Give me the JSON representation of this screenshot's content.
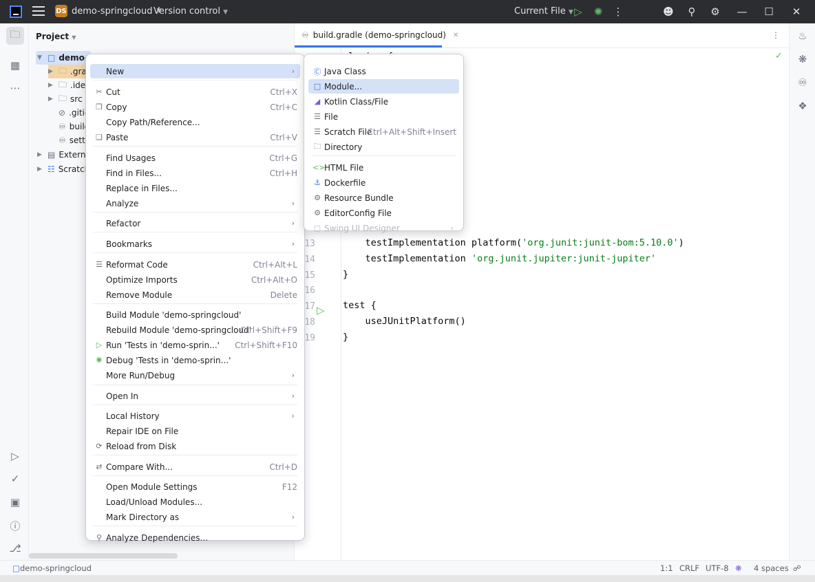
{
  "titlebar": {
    "badge": "DS",
    "project": "demo-springcloud",
    "vcs": "Version control",
    "run_config": "Current File"
  },
  "project_pane": {
    "title": "Project",
    "rows": [
      "demo-s",
      ".grac",
      ".idea",
      "src",
      ".gitic",
      "build",
      "setti",
      "External",
      "Scratche"
    ]
  },
  "editor": {
    "tab": "build.gradle (demo-springcloud)",
    "lines": [
      {
        "n": "13",
        "code": "    testImplementation platform(",
        "str": "'org.junit:junit-bom:5.10.0'",
        "tail": ")"
      },
      {
        "n": "14",
        "code": "    testImplementation ",
        "str": "'org.junit.jupiter:junit-jupiter'",
        "tail": ""
      },
      {
        "n": "15",
        "code": "}",
        "str": "",
        "tail": ""
      },
      {
        "n": "16",
        "code": "",
        "str": "",
        "tail": ""
      },
      {
        "n": "17",
        "code": "test {",
        "str": "",
        "tail": ""
      },
      {
        "n": "18",
        "code": "    useJUnitPlatform()",
        "str": "",
        "tail": ""
      },
      {
        "n": "19",
        "code": "}",
        "str": "",
        "tail": ""
      }
    ],
    "partial_top": "plugins {",
    "partial_t": "T'"
  },
  "context_menu": {
    "items": [
      {
        "label": "New",
        "shortcut": "",
        "sub": true
      },
      {
        "label": "Cut",
        "shortcut": "Ctrl+X",
        "sub": false
      },
      {
        "label": "Copy",
        "shortcut": "Ctrl+C",
        "sub": false
      },
      {
        "label": "Copy Path/Reference...",
        "shortcut": "",
        "sub": false
      },
      {
        "label": "Paste",
        "shortcut": "Ctrl+V",
        "sub": false
      },
      {
        "label": "Find Usages",
        "shortcut": "Ctrl+G",
        "sub": false
      },
      {
        "label": "Find in Files...",
        "shortcut": "Ctrl+H",
        "sub": false
      },
      {
        "label": "Replace in Files...",
        "shortcut": "",
        "sub": false
      },
      {
        "label": "Analyze",
        "shortcut": "",
        "sub": true
      },
      {
        "label": "Refactor",
        "shortcut": "",
        "sub": true
      },
      {
        "label": "Bookmarks",
        "shortcut": "",
        "sub": true
      },
      {
        "label": "Reformat Code",
        "shortcut": "Ctrl+Alt+L",
        "sub": false
      },
      {
        "label": "Optimize Imports",
        "shortcut": "Ctrl+Alt+O",
        "sub": false
      },
      {
        "label": "Remove Module",
        "shortcut": "Delete",
        "sub": false
      },
      {
        "label": "Build Module 'demo-springcloud'",
        "shortcut": "",
        "sub": false
      },
      {
        "label": "Rebuild Module 'demo-springcloud'",
        "shortcut": "Ctrl+Shift+F9",
        "sub": false
      },
      {
        "label": "Run 'Tests in 'demo-sprin...'",
        "shortcut": "Ctrl+Shift+F10",
        "sub": false
      },
      {
        "label": "Debug 'Tests in 'demo-sprin...'",
        "shortcut": "",
        "sub": false
      },
      {
        "label": "More Run/Debug",
        "shortcut": "",
        "sub": true
      },
      {
        "label": "Open In",
        "shortcut": "",
        "sub": true
      },
      {
        "label": "Local History",
        "shortcut": "",
        "sub": true
      },
      {
        "label": "Repair IDE on File",
        "shortcut": "",
        "sub": false
      },
      {
        "label": "Reload from Disk",
        "shortcut": "",
        "sub": false
      },
      {
        "label": "Compare With...",
        "shortcut": "Ctrl+D",
        "sub": false
      },
      {
        "label": "Open Module Settings",
        "shortcut": "F12",
        "sub": false
      },
      {
        "label": "Load/Unload Modules...",
        "shortcut": "",
        "sub": false
      },
      {
        "label": "Mark Directory as",
        "shortcut": "",
        "sub": true
      },
      {
        "label": "Analyze Dependencies...",
        "shortcut": "",
        "sub": false
      }
    ]
  },
  "submenu": {
    "items": [
      {
        "label": "Java Class",
        "shortcut": ""
      },
      {
        "label": "Module...",
        "shortcut": ""
      },
      {
        "label": "Kotlin Class/File",
        "shortcut": ""
      },
      {
        "label": "File",
        "shortcut": ""
      },
      {
        "label": "Scratch File",
        "shortcut": "Ctrl+Alt+Shift+Insert"
      },
      {
        "label": "Directory",
        "shortcut": ""
      },
      {
        "label": "HTML File",
        "shortcut": ""
      },
      {
        "label": "Dockerfile",
        "shortcut": ""
      },
      {
        "label": "Resource Bundle",
        "shortcut": ""
      },
      {
        "label": "EditorConfig File",
        "shortcut": ""
      },
      {
        "label": "Swing UI Designer",
        "shortcut": ""
      }
    ]
  },
  "statusbar": {
    "project": "demo-springcloud",
    "position": "1:1",
    "line_sep": "CRLF",
    "encoding": "UTF-8",
    "indent": "4 spaces"
  }
}
